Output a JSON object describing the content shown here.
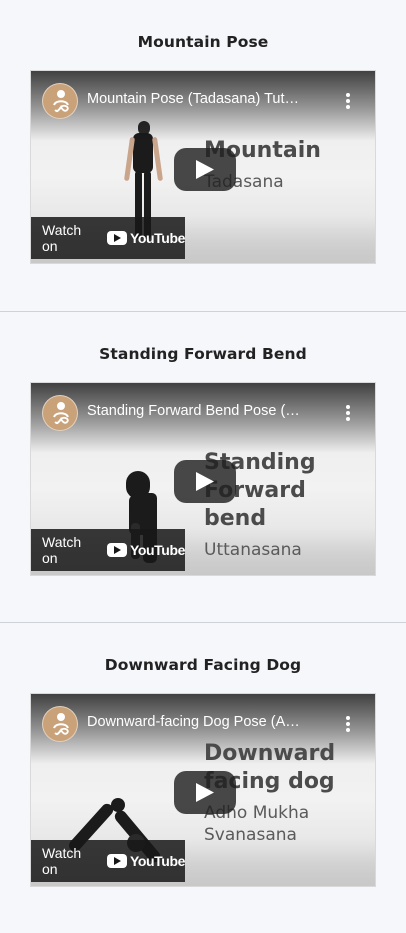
{
  "cards": [
    {
      "title": "Mountain Pose",
      "video": {
        "title": "Mountain Pose (Tadasana) Tut…",
        "overlay_big": [
          "Mountain"
        ],
        "overlay_sub": [
          "Tadasana"
        ],
        "watch_label": "Watch on",
        "brand": "YouTube"
      }
    },
    {
      "title": "Standing Forward Bend",
      "video": {
        "title": "Standing Forward Bend Pose (…",
        "overlay_big": [
          "Standing",
          "Forward bend"
        ],
        "overlay_sub": [
          "Uttanasana"
        ],
        "watch_label": "Watch on",
        "brand": "YouTube"
      }
    },
    {
      "title": "Downward Facing Dog",
      "video": {
        "title": "Downward-facing Dog Pose (A…",
        "overlay_big": [
          "Downward",
          "facing dog"
        ],
        "overlay_sub": [
          "Adho Mukha",
          "Svanasana"
        ],
        "watch_label": "Watch on",
        "brand": "YouTube"
      }
    }
  ],
  "colors": {
    "background": "#f6f7fb",
    "title_text": "#222222",
    "avatar": "#c9a27a"
  },
  "icons": {
    "avatar": "meditation-logo-icon",
    "play": "play-icon",
    "more": "more-vertical-icon",
    "youtube": "youtube-icon"
  }
}
